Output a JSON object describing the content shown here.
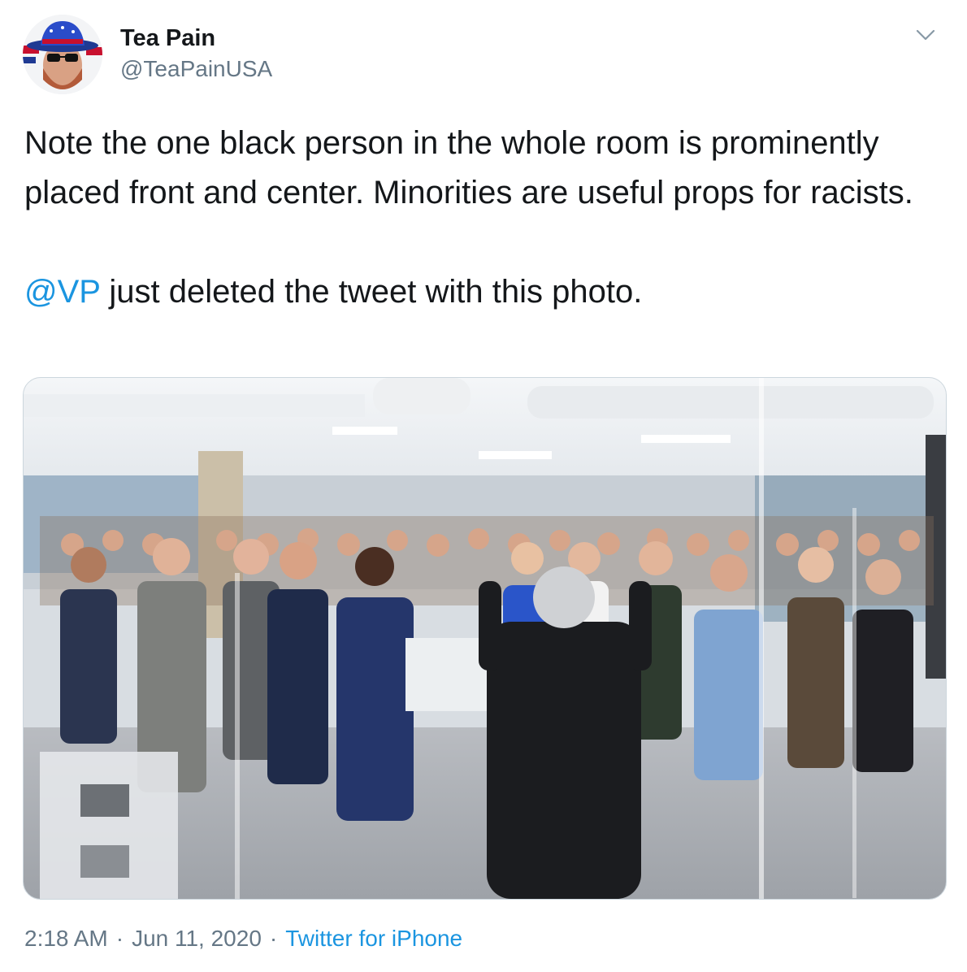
{
  "user": {
    "display_name": "Tea Pain",
    "handle": "@TeaPainUSA",
    "avatar_icon": "avatar-icon",
    "menu_icon": "chevron-down-icon"
  },
  "tweet": {
    "paragraph1": "Note the one black person in the whole room is prominently placed front and center. Minorities are useful props for racists.",
    "mention": "@VP",
    "paragraph2_rest": " just deleted the tweet with this photo."
  },
  "media": {
    "image_icon": "photo-image"
  },
  "meta": {
    "time": "2:18 AM",
    "separator": "·",
    "date": "Jun 11, 2020",
    "source": "Twitter for iPhone"
  },
  "colors": {
    "link": "#1b95e0",
    "secondary_text": "#657786",
    "primary_text": "#14171a"
  }
}
